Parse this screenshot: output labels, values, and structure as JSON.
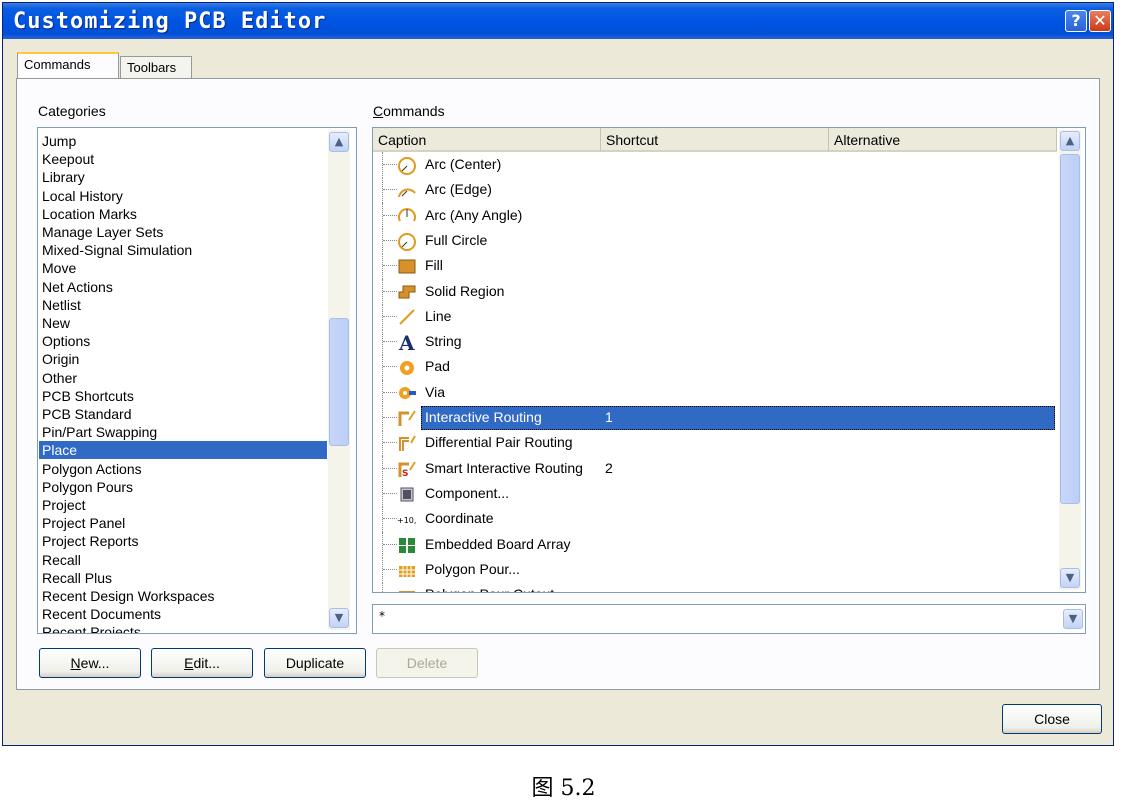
{
  "window": {
    "title": "Customizing PCB Editor",
    "help_glyph": "?",
    "close_glyph": "✕"
  },
  "tabs": [
    {
      "label": "Commands",
      "active": true
    },
    {
      "label": "Toolbars",
      "active": false
    }
  ],
  "categories": {
    "label": "Categories",
    "items": [
      "Jump",
      "Keepout",
      "Library",
      "Local History",
      "Location Marks",
      "Manage Layer Sets",
      "Mixed-Signal Simulation",
      "Move",
      "Net Actions",
      "Netlist",
      "New",
      "Options",
      "Origin",
      "Other",
      "PCB Shortcuts",
      "PCB Standard",
      "Pin/Part Swapping",
      "Place",
      "Polygon Actions",
      "Polygon Pours",
      "Project",
      "Project Panel",
      "Project Reports",
      "Recall",
      "Recall Plus",
      "Recent Design Workspaces",
      "Recent Documents",
      "Recent Projects"
    ],
    "selected": "Place"
  },
  "commands": {
    "label": "Commands",
    "columns": [
      "Caption",
      "Shortcut",
      "Alternative"
    ],
    "rows": [
      {
        "icon": "arc-center-icon",
        "caption": "Arc (Center)",
        "shortcut": ""
      },
      {
        "icon": "arc-edge-icon",
        "caption": "Arc (Edge)",
        "shortcut": ""
      },
      {
        "icon": "arc-any-angle-icon",
        "caption": "Arc (Any Angle)",
        "shortcut": ""
      },
      {
        "icon": "full-circle-icon",
        "caption": "Full Circle",
        "shortcut": ""
      },
      {
        "icon": "fill-icon",
        "caption": "Fill",
        "shortcut": ""
      },
      {
        "icon": "solid-region-icon",
        "caption": "Solid Region",
        "shortcut": ""
      },
      {
        "icon": "line-icon",
        "caption": "Line",
        "shortcut": ""
      },
      {
        "icon": "string-icon",
        "caption": "String",
        "shortcut": ""
      },
      {
        "icon": "pad-icon",
        "caption": "Pad",
        "shortcut": ""
      },
      {
        "icon": "via-icon",
        "caption": "Via",
        "shortcut": ""
      },
      {
        "icon": "interactive-routing-icon",
        "caption": "Interactive Routing",
        "shortcut": "1",
        "selected": true
      },
      {
        "icon": "differential-pair-routing-icon",
        "caption": "Differential Pair Routing",
        "shortcut": ""
      },
      {
        "icon": "smart-interactive-routing-icon",
        "caption": "Smart Interactive Routing",
        "shortcut": "2"
      },
      {
        "icon": "component-icon",
        "caption": "Component...",
        "shortcut": ""
      },
      {
        "icon": "coordinate-icon",
        "caption": "Coordinate",
        "shortcut": ""
      },
      {
        "icon": "embedded-board-array-icon",
        "caption": "Embedded Board Array",
        "shortcut": ""
      },
      {
        "icon": "polygon-pour-icon",
        "caption": "Polygon Pour...",
        "shortcut": ""
      },
      {
        "icon": "polygon-pour-cutout-icon",
        "caption": "Polygon Pour Cutout",
        "shortcut": ""
      }
    ],
    "filter_value": "*"
  },
  "buttons": {
    "new": "New...",
    "edit": "Edit...",
    "duplicate": "Duplicate",
    "delete": "Delete",
    "close": "Close"
  },
  "figure_caption": "图 5.2"
}
